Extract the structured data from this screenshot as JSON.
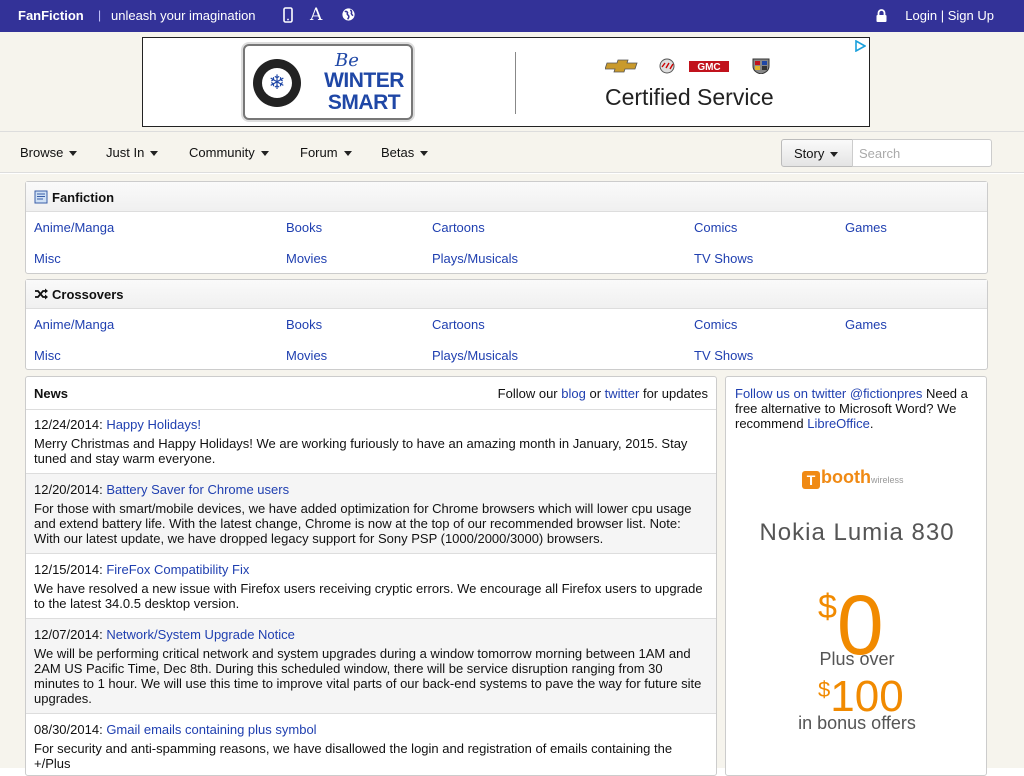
{
  "topbar": {
    "brand": "FanFiction",
    "separator": "|",
    "tagline": "unleash your imagination",
    "login": "Login",
    "signup_sep": "|",
    "signup": "Sign Up",
    "colors": {
      "bar": "#333298",
      "link": "#1f3fb0"
    }
  },
  "banner": {
    "be": "Be",
    "winter_smart": "WINTER SMART",
    "certified": "Certified Service",
    "logos": [
      "chevrolet-logo",
      "buick-logo",
      "gmc-logo",
      "cadillac-logo"
    ]
  },
  "nav": {
    "items": [
      "Browse",
      "Just In",
      "Community",
      "Forum",
      "Betas"
    ],
    "story_label": "Story",
    "search_placeholder": "Search"
  },
  "fanfiction": {
    "title": "Fanfiction",
    "categories": [
      "Anime/Manga",
      "Books",
      "Cartoons",
      "Comics",
      "Games",
      "Misc",
      "Movies",
      "Plays/Musicals",
      "TV Shows"
    ]
  },
  "crossovers": {
    "title": "Crossovers",
    "categories": [
      "Anime/Manga",
      "Books",
      "Cartoons",
      "Comics",
      "Games",
      "Misc",
      "Movies",
      "Plays/Musicals",
      "TV Shows"
    ]
  },
  "news": {
    "title": "News",
    "follow_prefix": "Follow our",
    "blog": "blog",
    "or": "or",
    "twitter": "twitter",
    "follow_suffix": "for updates",
    "items": [
      {
        "date": "12/24/2014:",
        "title": "Happy Holidays!",
        "body": "Merry Christmas and Happy Holidays! We are working furiously to have an amazing month in January, 2015. Stay tuned and stay warm everyone."
      },
      {
        "date": "12/20/2014:",
        "title": "Battery Saver for Chrome users",
        "body": "For those with smart/mobile devices, we have added optimization for Chrome browsers which will lower cpu usage and extend battery life. With the latest change, Chrome is now at the top of our recommended browser list. Note: With our latest update, we have dropped legacy support for Sony PSP (1000/2000/3000) browsers."
      },
      {
        "date": "12/15/2014:",
        "title": "FireFox Compatibility Fix",
        "body": "We have resolved a new issue with Firefox users receiving cryptic errors. We encourage all Firefox users to upgrade to the latest 34.0.5  desktop version."
      },
      {
        "date": "12/07/2014:",
        "title": "Network/System Upgrade Notice",
        "body": "We will be performing critical network and system upgrades during a window tomorrow morning between 1AM and 2AM US Pacific Time, Dec 8th. During this scheduled  window, there will be service disruption ranging from 30 minutes to 1 hour. We will use this time to improve vital parts of our back-end systems to pave the way for future site upgrades."
      },
      {
        "date": "08/30/2014:",
        "title": "Gmail emails containing plus symbol",
        "body": "For security and anti-spamming reasons, we have disallowed the login and registration of emails containing the +/Plus"
      }
    ]
  },
  "side": {
    "follow_link": "Follow us on twitter @fictionpres",
    "text": "Need a free alternative to Microsoft Word? We recommend",
    "libre": "LibreOffice",
    "period": "."
  },
  "boost_ad": {
    "logo_mark": "T",
    "logo": "booth",
    "logo_small": "wireless",
    "phone": "Nokia Lumia 830",
    "price_sym": "$",
    "price": "0",
    "plus_over": "Plus over",
    "bonus_sym": "$",
    "bonus": "100",
    "bonus_text": "in bonus offers",
    "color": "#f18a00"
  }
}
